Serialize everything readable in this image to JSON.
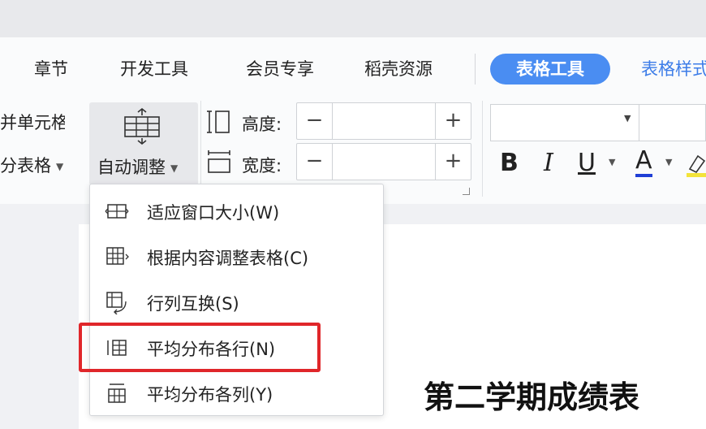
{
  "tabs": [
    {
      "label": "章节"
    },
    {
      "label": "开发工具"
    },
    {
      "label": "会员专享"
    },
    {
      "label": "稻壳资源"
    }
  ],
  "active_tab": "表格工具",
  "next_tab_partial": "表格样式",
  "left_group": {
    "merge_cells": "合并单元格",
    "split_table": "拆分表格"
  },
  "auto_adjust": {
    "label": "自动调整"
  },
  "dimensions": {
    "height_label": "高度:",
    "width_label": "宽度:",
    "minus": "−",
    "plus": "+"
  },
  "format": {
    "bold": "B",
    "italic": "I",
    "underline": "U",
    "font_color": "A"
  },
  "menu": {
    "items": [
      {
        "label": "适应窗口大小(W)",
        "icon": "fit-window-icon"
      },
      {
        "label": "根据内容调整表格(C)",
        "icon": "fit-content-icon"
      },
      {
        "label": "行列互换(S)",
        "icon": "swap-rows-columns-icon"
      },
      {
        "label": "平均分布各行(N)",
        "icon": "distribute-rows-icon"
      },
      {
        "label": "平均分布各列(Y)",
        "icon": "distribute-columns-icon"
      }
    ]
  },
  "document": {
    "title": "第二学期成绩表"
  },
  "colors": {
    "accent": "#4a8df2",
    "highlight_border": "#e0262a",
    "font_color_underline": "#1f3fd6",
    "highlighter": "#f3e33a"
  }
}
